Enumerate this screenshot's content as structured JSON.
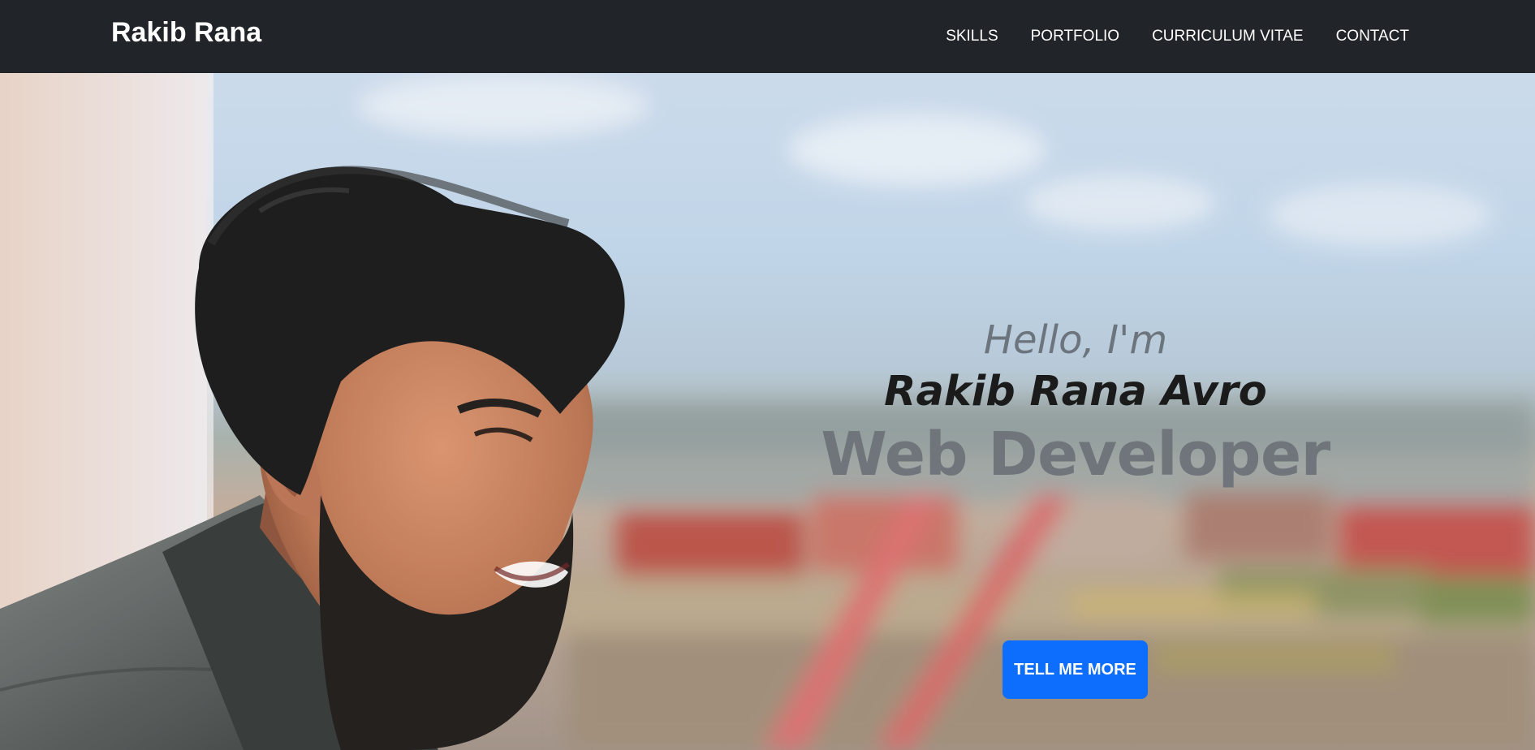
{
  "navbar": {
    "brand": "Rakib Rana",
    "links": [
      {
        "label": "SKILLS"
      },
      {
        "label": "PORTFOLIO"
      },
      {
        "label": "CURRICULUM VITAE"
      },
      {
        "label": "CONTACT"
      }
    ]
  },
  "hero": {
    "greeting": "Hello, I'm",
    "name": "Rakib Rana Avro",
    "role": "Web Developer",
    "cta_label": "TELL ME MORE"
  },
  "colors": {
    "navbar_bg": "#212529",
    "accent": "#0d6efd",
    "muted_text": "#6c757d",
    "dark_text": "#1b1b1b"
  }
}
